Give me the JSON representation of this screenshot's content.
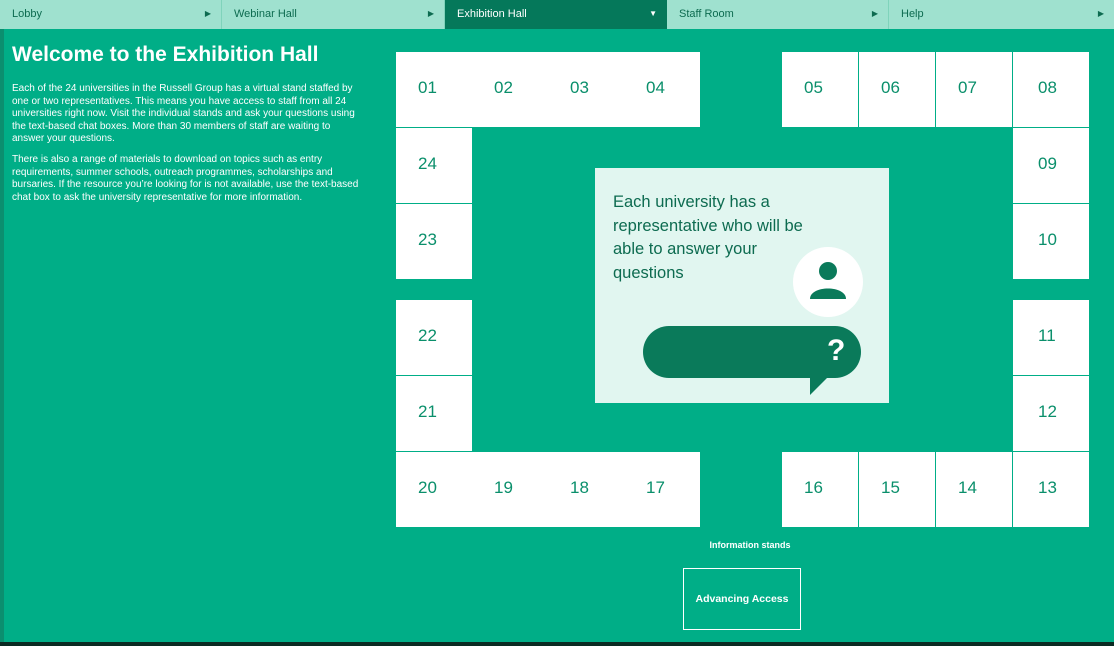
{
  "nav": {
    "items": [
      {
        "label": "Lobby",
        "arrow": "▶"
      },
      {
        "label": "Webinar Hall",
        "arrow": "▶"
      },
      {
        "label": "Exhibition Hall",
        "arrow": "▼"
      },
      {
        "label": "Staff Room",
        "arrow": "▶"
      },
      {
        "label": "Help",
        "arrow": "▶"
      }
    ]
  },
  "intro": {
    "title": "Welcome to the Exhibition Hall",
    "para1": "Each of the 24 universities in the Russell Group has a virtual stand staffed by one or two representatives. This means you have access to staff from all 24 universities right now. Visit the individual stands and ask your questions using the text-based chat boxes. More than 30 members of staff are waiting to answer your questions.",
    "para2": "There is also a range of materials to download on topics such as entry requirements, summer schools, outreach programmes, scholarships and bursaries. If the resource you’re looking for is not available, use the text-based chat box to ask the university representative for more information."
  },
  "stands": {
    "s01": "01",
    "s02": "02",
    "s03": "03",
    "s04": "04",
    "s05": "05",
    "s06": "06",
    "s07": "07",
    "s08": "08",
    "s09": "09",
    "s10": "10",
    "s11": "11",
    "s12": "12",
    "s13": "13",
    "s14": "14",
    "s15": "15",
    "s16": "16",
    "s17": "17",
    "s18": "18",
    "s19": "19",
    "s20": "20",
    "s21": "21",
    "s22": "22",
    "s23": "23",
    "s24": "24"
  },
  "card": {
    "text": "Each university has a representative who will be able to answer your questions",
    "question_mark": "?"
  },
  "info": {
    "label": "Information stands",
    "advancing_access": "Advancing Access"
  },
  "colors": {
    "background": "#00ae87",
    "nav_bg": "#9fe1cf",
    "nav_active": "#05785a",
    "dark_green": "#0a7a5a",
    "card_bg": "#e1f6f0"
  }
}
